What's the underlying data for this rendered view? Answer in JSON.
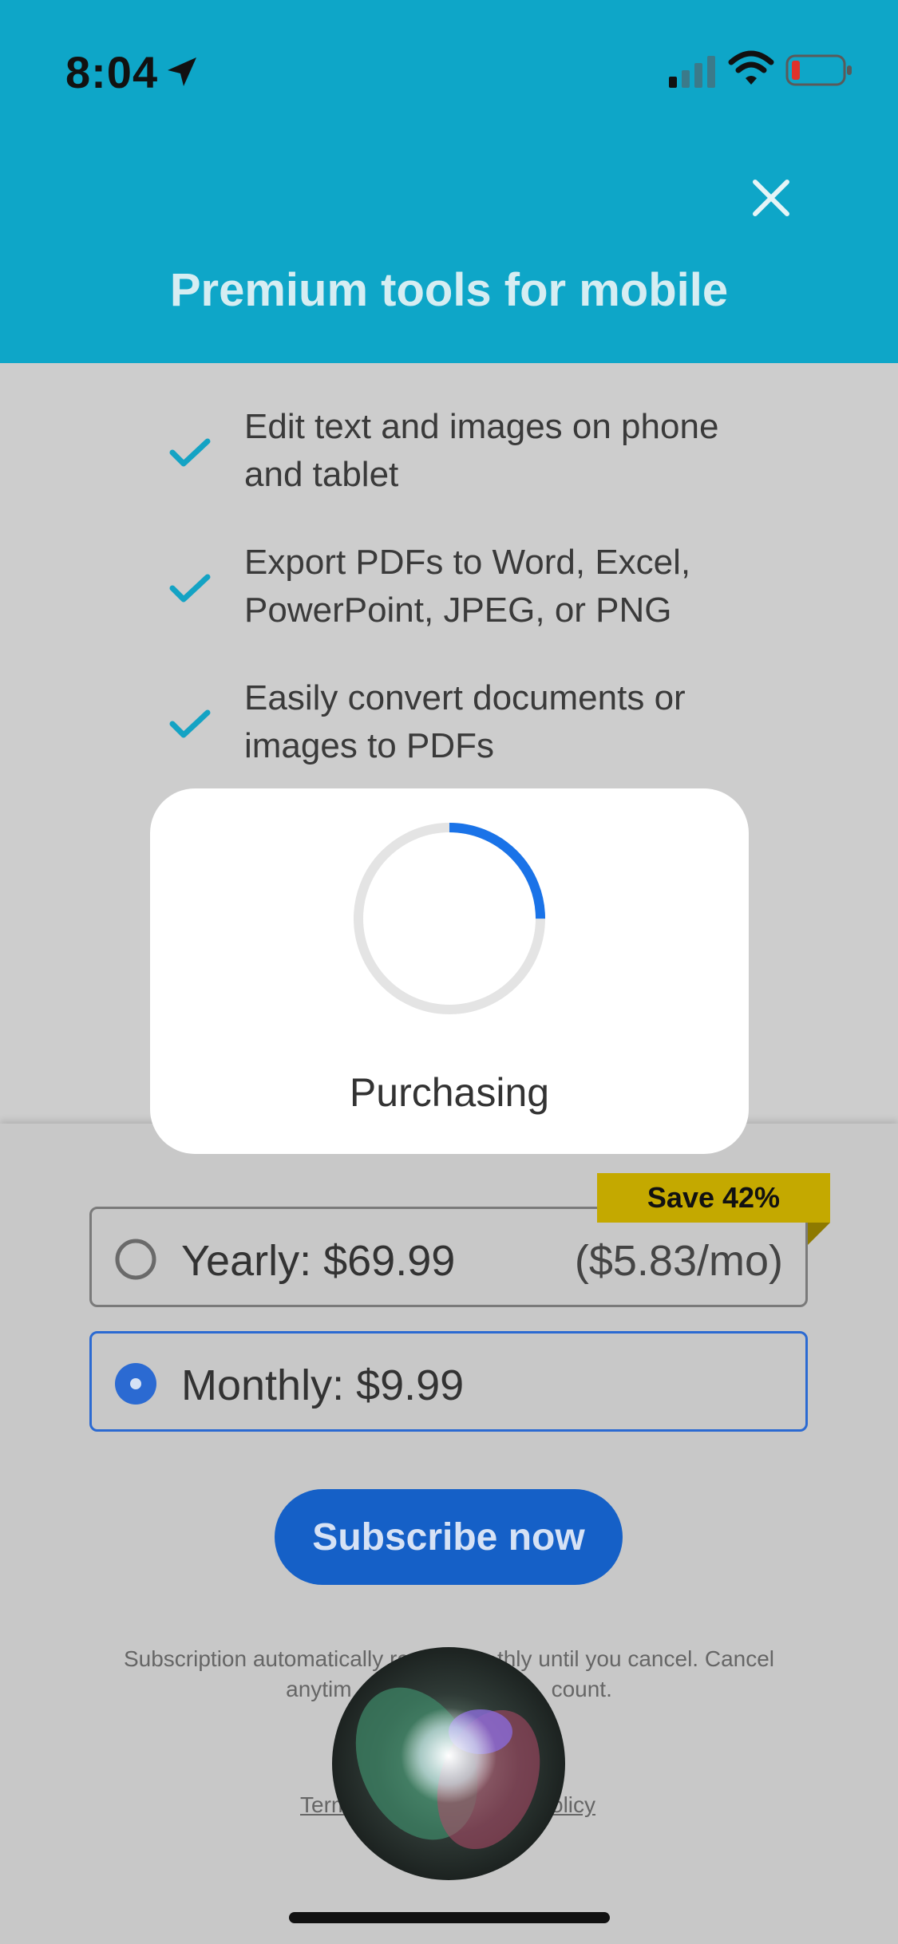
{
  "status_bar": {
    "time": "8:04",
    "icons": [
      "location-arrow-icon",
      "signal-icon",
      "wifi-icon",
      "battery-low-icon"
    ]
  },
  "header": {
    "title": "Premium tools for mobile",
    "close_icon": "close-icon",
    "background_color": "#0ea6c8"
  },
  "features": [
    {
      "line1": "Edit text and images on phone",
      "line2": "and tablet"
    },
    {
      "line1": "Export PDFs to Word, Excel,",
      "line2": "PowerPoint, JPEG, or PNG"
    },
    {
      "line1": "Easily convert documents or",
      "line2": "images to PDFs"
    }
  ],
  "dialog": {
    "label": "Purchasing",
    "progress_fraction": 0.25,
    "accent_color": "#1a73e8"
  },
  "plans": {
    "badge": "Save 42%",
    "yearly": {
      "label": "Yearly: $69.99",
      "per_month": "($5.83/mo)",
      "selected": false
    },
    "monthly": {
      "label": "Monthly: $9.99",
      "selected": true
    }
  },
  "subscribe": {
    "label": "Subscribe now",
    "color": "#1560c7"
  },
  "fineprint": {
    "line1": "Subscription automatically re",
    "line1_end": "thly until you cancel. Cancel",
    "line2": "anytim",
    "line2_end": "count.",
    "terms": "Term",
    "policy": "olicy"
  }
}
